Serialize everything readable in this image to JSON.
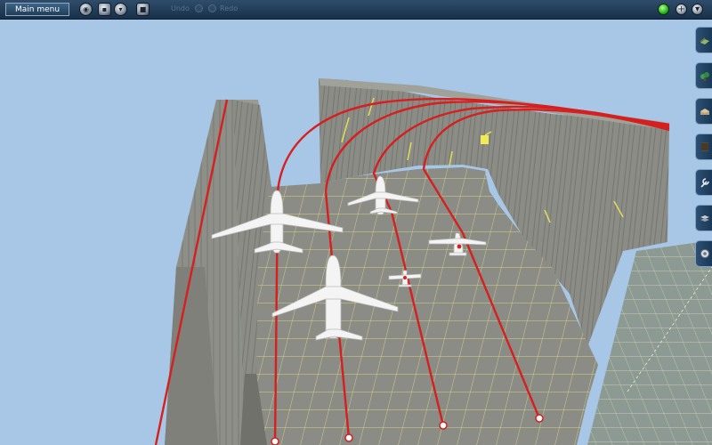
{
  "toolbar": {
    "main_menu_label": "Main menu",
    "undo_label": "Undo",
    "redo_label": "Redo"
  },
  "side_tabs": [
    {
      "icon": "scenery-object-icon"
    },
    {
      "icon": "vegetation-icon"
    },
    {
      "icon": "building-icon"
    },
    {
      "icon": "texture-icon"
    },
    {
      "icon": "wrench-icon"
    },
    {
      "icon": "layers-icon"
    },
    {
      "icon": "settings-icon"
    }
  ],
  "colors": {
    "sky": "#a8c6e6",
    "apron_surface": "#888a82",
    "wall_surface": "#8b8d86",
    "grid_line": "#e4e07a",
    "taxi_line": "#d61f1f",
    "status_led": "#2fbf22"
  },
  "scene": {
    "aircraft": [
      "large-jet",
      "large-jet",
      "mid-jet",
      "propeller-plane",
      "small-plane"
    ]
  }
}
